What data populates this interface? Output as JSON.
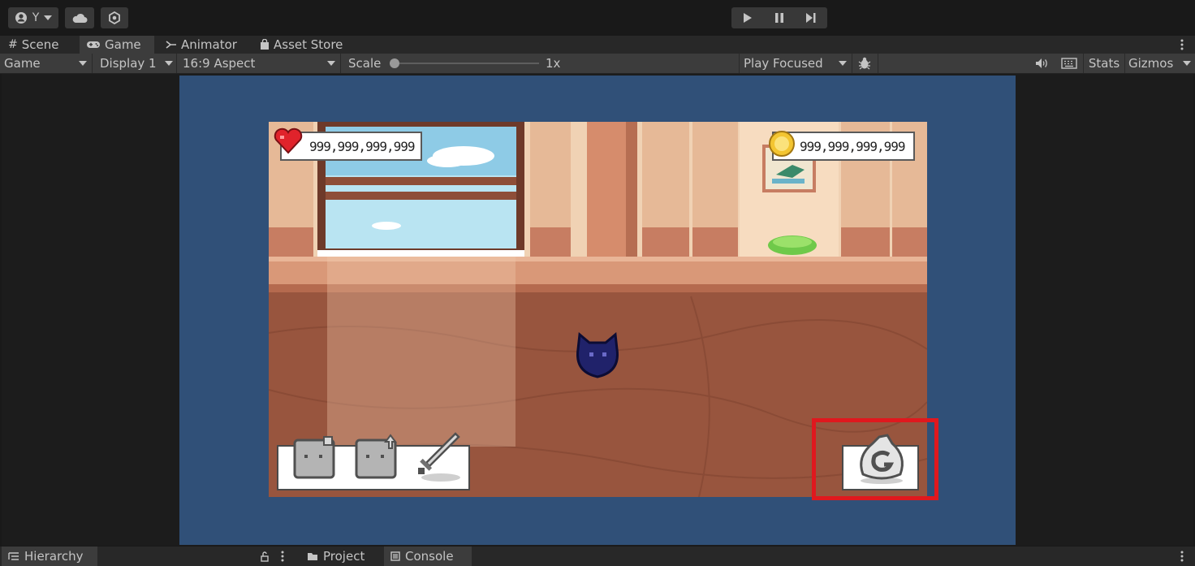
{
  "toolbar": {
    "account_label": "Y",
    "account_icon": "account-icon",
    "cloud_icon": "cloud-icon",
    "collab_icon": "collab-icon",
    "play_icon": "play-icon",
    "pause_icon": "pause-icon",
    "step_icon": "step-icon"
  },
  "tabs": [
    {
      "label": "Scene",
      "icon": "grid-icon"
    },
    {
      "label": "Game",
      "icon": "gamepad-icon",
      "active": true
    },
    {
      "label": "Animator",
      "icon": "animator-icon"
    },
    {
      "label": "Asset Store",
      "icon": "bag-icon"
    }
  ],
  "game_toolbar": {
    "view_mode": "Game",
    "display": "Display 1",
    "aspect": "16:9 Aspect",
    "scale_label": "Scale",
    "scale_value": "1x",
    "scale_fraction": 0.0,
    "play_mode": "Play Focused",
    "stats": "Stats",
    "gizmos": "Gizmos"
  },
  "hud": {
    "health_value": "999,999,999,999",
    "gold_value": "999,999,999,999"
  },
  "bottom_tabs": [
    {
      "label": "Hierarchy",
      "icon": "hierarchy-icon"
    },
    {
      "label": "Project",
      "icon": "folder-icon"
    },
    {
      "label": "Console",
      "icon": "console-icon",
      "active": true
    }
  ],
  "colors": {
    "highlight": "#e0181e",
    "game_background": "#305078",
    "editor_background": "#191919"
  }
}
